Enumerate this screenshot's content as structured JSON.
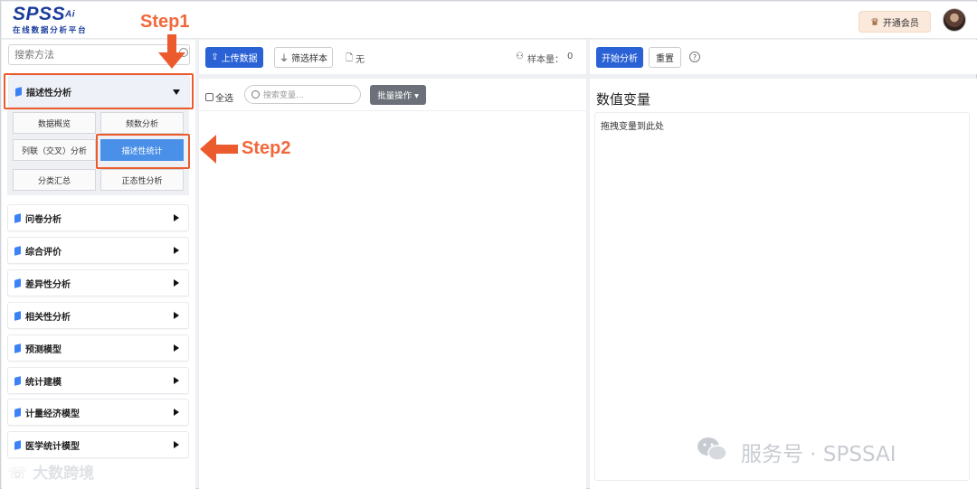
{
  "header": {
    "logo_main": "SPSS",
    "logo_ai": "Ai",
    "logo_sub": "在线数据分析平台",
    "vip_label": "开通会员",
    "crown_icon": "crown-icon",
    "avatar_icon": "avatar-icon"
  },
  "sidebar": {
    "search_placeholder": "搜索方法",
    "open_category": "描述性分析",
    "sub_items": [
      "数据概览",
      "频数分析",
      "列联（交叉）分析",
      "描述性统计",
      "分类汇总",
      "正态性分析"
    ],
    "active_sub": "描述性统计",
    "categories": [
      "问卷分析",
      "综合评价",
      "差异性分析",
      "相关性分析",
      "预测模型",
      "统计建模",
      "计量经济模型",
      "医学统计模型"
    ]
  },
  "middle": {
    "upload_label": "上传数据",
    "filter_label": "筛选样本",
    "file_label": "无",
    "sample_label": "样本量：",
    "sample_count": "0",
    "select_all": "全选",
    "search_placeholder": "搜索变量...",
    "batch_label": "批量操作 ▾"
  },
  "right": {
    "start_label": "开始分析",
    "reset_label": "重置",
    "help_label": "?",
    "panel_title": "数值变量",
    "drop_hint": "拖拽变量到此处"
  },
  "annotations": {
    "step1": "Step1",
    "step2": "Step2"
  },
  "watermark": {
    "wechat": "服务号 · SPSSAI",
    "left": "大数跨境"
  },
  "colors": {
    "accent_blue": "#2a62d6",
    "active_sub": "#4a90e8",
    "annotation_orange": "#ec5b2e"
  }
}
